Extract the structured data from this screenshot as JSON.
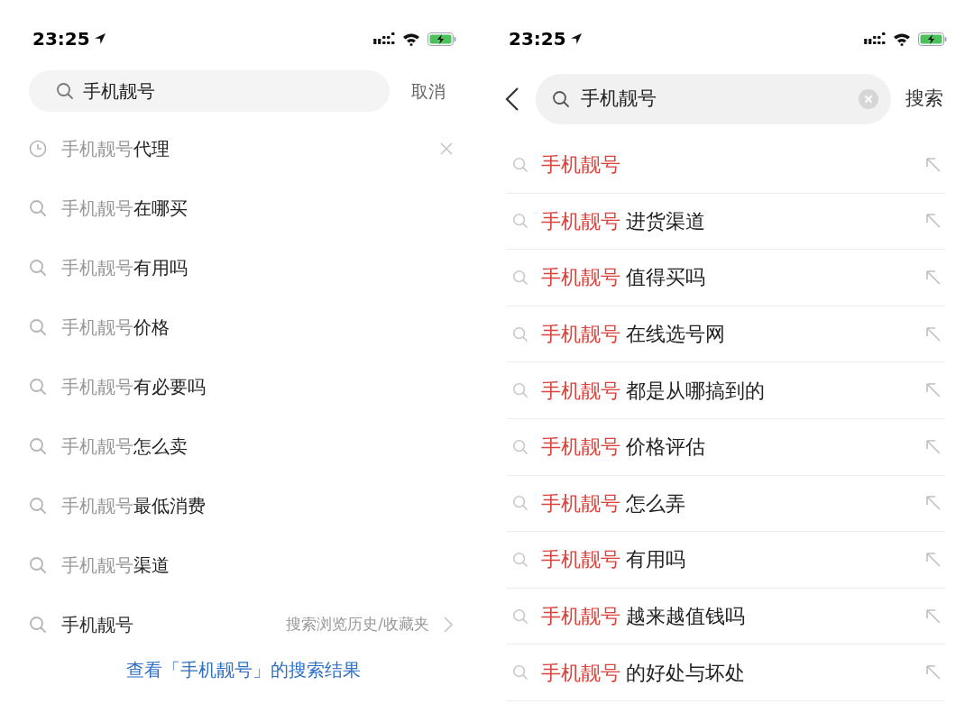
{
  "left_screen": {
    "status_bar": {
      "time": "23:25"
    },
    "search": {
      "value": "手机靓号"
    },
    "cancel_button": "取消",
    "suggestions": [
      {
        "kind": "history",
        "prefix": "手机靓号",
        "suffix": "代理"
      },
      {
        "kind": "search",
        "prefix": "手机靓号",
        "suffix": "在哪买"
      },
      {
        "kind": "search",
        "prefix": "手机靓号",
        "suffix": "有用吗"
      },
      {
        "kind": "search",
        "prefix": "手机靓号",
        "suffix": "价格"
      },
      {
        "kind": "search",
        "prefix": "手机靓号",
        "suffix": "有必要吗"
      },
      {
        "kind": "search",
        "prefix": "手机靓号",
        "suffix": "怎么卖"
      },
      {
        "kind": "search",
        "prefix": "手机靓号",
        "suffix": "最低消费"
      },
      {
        "kind": "search",
        "prefix": "手机靓号",
        "suffix": "渠道"
      },
      {
        "kind": "browse",
        "text": "手机靓号",
        "hint": "搜索浏览历史/收藏夹"
      }
    ],
    "results_link": "查看「手机靓号」的搜索结果"
  },
  "right_screen": {
    "status_bar": {
      "time": "23:25"
    },
    "search": {
      "value": "手机靓号"
    },
    "search_button": "搜索",
    "suggestions": [
      {
        "prefix": "手机靓号"
      },
      {
        "prefix": "手机靓号",
        "suffix": "进货渠道"
      },
      {
        "prefix": "手机靓号",
        "suffix": "值得买吗"
      },
      {
        "prefix": "手机靓号",
        "suffix": "在线选号网"
      },
      {
        "prefix": "手机靓号",
        "suffix": "都是从哪搞到的"
      },
      {
        "prefix": "手机靓号",
        "suffix": "价格评估"
      },
      {
        "prefix": "手机靓号",
        "suffix": "怎么弄"
      },
      {
        "prefix": "手机靓号",
        "suffix": "有用吗"
      },
      {
        "prefix": "手机靓号",
        "suffix": "越来越值钱吗"
      },
      {
        "prefix": "手机靓号",
        "suffix": "的好处与坏处"
      }
    ]
  }
}
